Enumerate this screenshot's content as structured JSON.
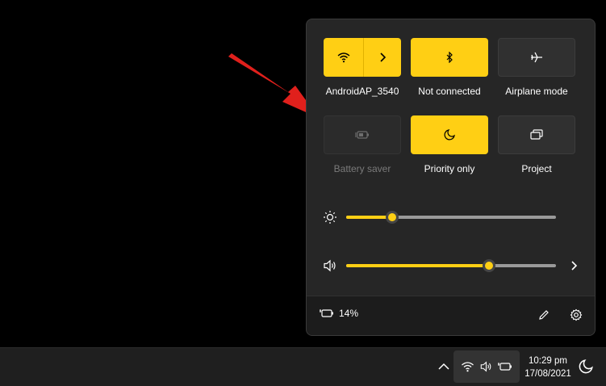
{
  "quick_settings": {
    "tiles": [
      {
        "label": "AndroidAP_3540",
        "icon": "wifi-icon",
        "state": "on",
        "has_arrow": true
      },
      {
        "label": "Not connected",
        "icon": "bluetooth-icon",
        "state": "on"
      },
      {
        "label": "Airplane mode",
        "icon": "airplane-icon",
        "state": "off"
      },
      {
        "label": "Battery saver",
        "icon": "battery-saver-icon",
        "state": "disabled"
      },
      {
        "label": "Priority only",
        "icon": "moon-icon",
        "state": "on"
      },
      {
        "label": "Project",
        "icon": "project-icon",
        "state": "off"
      }
    ],
    "brightness": {
      "icon": "brightness-icon",
      "level": 0.22
    },
    "volume": {
      "icon": "speaker-icon",
      "level": 0.68
    },
    "battery": {
      "icon": "battery-icon",
      "percent_label": "14%"
    },
    "footer_icons": [
      "pencil-icon",
      "gear-icon"
    ]
  },
  "taskbar": {
    "time": "10:29 pm",
    "date": "17/08/2021",
    "tray_icons": [
      "chevron-up-icon",
      "wifi-icon",
      "speaker-icon",
      "battery-icon",
      "moon-icon"
    ]
  },
  "colors": {
    "accent": "#ffcf14",
    "panel": "#262626",
    "annotation_arrow": "#e0201c"
  }
}
